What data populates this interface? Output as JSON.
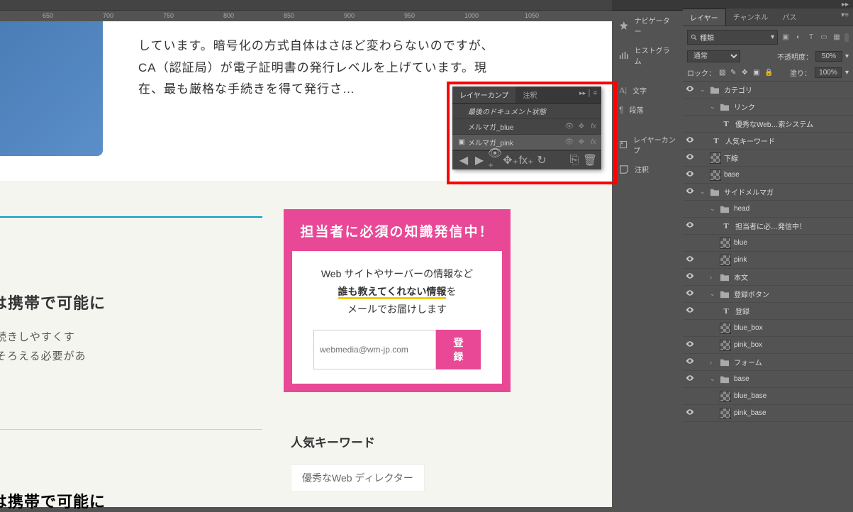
{
  "ruler_marks": [
    {
      "pos": 60,
      "label": "650"
    },
    {
      "pos": 145,
      "label": "700"
    },
    {
      "pos": 230,
      "label": "750"
    },
    {
      "pos": 315,
      "label": "800"
    },
    {
      "pos": 400,
      "label": "850"
    },
    {
      "pos": 485,
      "label": "900"
    },
    {
      "pos": 570,
      "label": "950"
    },
    {
      "pos": 655,
      "label": "1000"
    },
    {
      "pos": 740,
      "label": "1050"
    }
  ],
  "article1": "しています。暗号化の方式自体はさほど変わらないのですが、CA（認証局）が電子証明書の発行レベルを上げています。現在、最も厳格な手続きを得て発行さ…",
  "article2": {
    "title": "結　本人確認は携帯で可能に",
    "body": "ターネットで納税手続きしやすくす\nめの機器を利用者がそろえる必要があ\nきるよう…"
  },
  "article3_title": "結　本人確認は携帯で可能に",
  "newsletter": {
    "heading": "担当者に必須の知識発信中！",
    "line1": "Web サイトやサーバーの情報など",
    "highlight": "誰も教えてくれない情報",
    "line2_suffix": "を",
    "line3": "メールでお届けします",
    "placeholder": "webmedia@wm-jp.com",
    "button": "登録"
  },
  "popular": {
    "heading": "人気キーワード",
    "item": "優秀なWeb ディレクター"
  },
  "dock": {
    "navigator": "ナビゲーター",
    "histogram": "ヒストグラム",
    "character": "文字",
    "paragraph": "段落",
    "layercomps": "レイヤーカンプ",
    "notes": "注釈"
  },
  "layers_panel": {
    "tabs": {
      "layers": "レイヤー",
      "channels": "チャンネル",
      "paths": "パス"
    },
    "filter_label": "種類",
    "blend_mode": "通常",
    "opacity_label": "不透明度：",
    "opacity_value": "50%",
    "lock_label": "ロック：",
    "fill_label": "塗り：",
    "fill_value": "100%"
  },
  "layers": [
    {
      "depth": 0,
      "type": "folder",
      "open": true,
      "name": "カテゴリ",
      "eye": true
    },
    {
      "depth": 1,
      "type": "folder",
      "open": true,
      "name": "リンク",
      "eye": false
    },
    {
      "depth": 2,
      "type": "text",
      "name": "優秀なWeb…索システム",
      "eye": false
    },
    {
      "depth": 1,
      "type": "text",
      "name": "人気キーワード",
      "eye": true
    },
    {
      "depth": 1,
      "type": "thumb",
      "name": "下線",
      "eye": true
    },
    {
      "depth": 1,
      "type": "thumb",
      "name": "base",
      "eye": true
    },
    {
      "depth": 0,
      "type": "folder",
      "open": true,
      "name": "サイドメルマガ",
      "eye": true
    },
    {
      "depth": 1,
      "type": "folder",
      "open": true,
      "name": "head",
      "eye": false
    },
    {
      "depth": 2,
      "type": "text",
      "name": "担当者に必…発信中！",
      "eye": true
    },
    {
      "depth": 2,
      "type": "thumb",
      "name": "blue",
      "eye": false
    },
    {
      "depth": 2,
      "type": "thumb",
      "name": "pink",
      "eye": true
    },
    {
      "depth": 1,
      "type": "folder",
      "open": false,
      "name": "本文",
      "eye": true
    },
    {
      "depth": 1,
      "type": "folder",
      "open": true,
      "name": "登録ボタン",
      "eye": true
    },
    {
      "depth": 2,
      "type": "text",
      "name": "登録",
      "eye": true
    },
    {
      "depth": 2,
      "type": "thumb",
      "name": "blue_box",
      "eye": false
    },
    {
      "depth": 2,
      "type": "thumb",
      "name": "pink_box",
      "eye": true
    },
    {
      "depth": 1,
      "type": "folder",
      "open": false,
      "name": "フォーム",
      "eye": true
    },
    {
      "depth": 1,
      "type": "folder",
      "open": true,
      "name": "base",
      "eye": true
    },
    {
      "depth": 2,
      "type": "thumb",
      "name": "blue_base",
      "eye": false
    },
    {
      "depth": 2,
      "type": "thumb",
      "name": "pink_base",
      "eye": true
    }
  ],
  "layercomp": {
    "tabs": {
      "comps": "レイヤーカンプ",
      "notes": "注釈"
    },
    "last_state": "最後のドキュメント状態",
    "rows": [
      {
        "name": "メルマガ_blue",
        "selected": false
      },
      {
        "name": "メルマガ_pink",
        "selected": true
      }
    ]
  }
}
